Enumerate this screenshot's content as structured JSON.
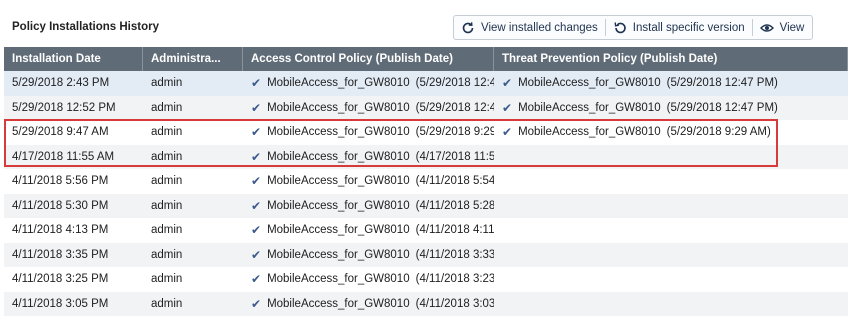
{
  "title": "Policy Installations History",
  "toolbar": {
    "view_changes": "View installed changes",
    "install_version": "Install specific version",
    "view": "View"
  },
  "columns": [
    "Installation Date",
    "Administra...",
    "Access Control Policy (Publish Date)",
    "Threat Prevention Policy (Publish Date)"
  ],
  "rows": [
    {
      "date": "5/29/2018 2:43 PM",
      "admin": "admin",
      "acp": "MobileAccess_for_GW8010",
      "acp_date": "(5/29/2018 12:4",
      "tpp": "MobileAccess_for_GW8010",
      "tpp_date": "(5/29/2018 12:47 PM)"
    },
    {
      "date": "5/29/2018 12:52 PM",
      "admin": "admin",
      "acp": "MobileAccess_for_GW8010",
      "acp_date": "(5/29/2018 12:4",
      "tpp": "MobileAccess_for_GW8010",
      "tpp_date": "(5/29/2018 12:47 PM)"
    },
    {
      "date": "5/29/2018 9:47 AM",
      "admin": "admin",
      "acp": "MobileAccess_for_GW8010",
      "acp_date": "(5/29/2018 9:29",
      "tpp": "MobileAccess_for_GW8010",
      "tpp_date": "(5/29/2018 9:29 AM)"
    },
    {
      "date": "4/17/2018 11:55 AM",
      "admin": "admin",
      "acp": "MobileAccess_for_GW8010",
      "acp_date": "(4/17/2018 11:5",
      "tpp": "",
      "tpp_date": ""
    },
    {
      "date": "4/11/2018 5:56 PM",
      "admin": "admin",
      "acp": "MobileAccess_for_GW8010",
      "acp_date": "(4/11/2018 5:54",
      "tpp": "",
      "tpp_date": ""
    },
    {
      "date": "4/11/2018 5:30 PM",
      "admin": "admin",
      "acp": "MobileAccess_for_GW8010",
      "acp_date": "(4/11/2018 5:28",
      "tpp": "",
      "tpp_date": ""
    },
    {
      "date": "4/11/2018 4:13 PM",
      "admin": "admin",
      "acp": "MobileAccess_for_GW8010",
      "acp_date": "(4/11/2018 4:11",
      "tpp": "",
      "tpp_date": ""
    },
    {
      "date": "4/11/2018 3:35 PM",
      "admin": "admin",
      "acp": "MobileAccess_for_GW8010",
      "acp_date": "(4/11/2018 3:33",
      "tpp": "",
      "tpp_date": ""
    },
    {
      "date": "4/11/2018 3:25 PM",
      "admin": "admin",
      "acp": "MobileAccess_for_GW8010",
      "acp_date": "(4/11/2018 3:23",
      "tpp": "",
      "tpp_date": ""
    },
    {
      "date": "4/11/2018 3:05 PM",
      "admin": "admin",
      "acp": "MobileAccess_for_GW8010",
      "acp_date": "(4/11/2018 3:03",
      "tpp": "",
      "tpp_date": ""
    }
  ],
  "check_glyph": "✔",
  "colors": {
    "header": "#5f6b77",
    "selected_row": "#e3ebf5",
    "highlight_border": "#d63a3a",
    "icon": "#1f3350"
  }
}
